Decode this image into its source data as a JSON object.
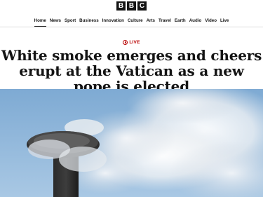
{
  "logo": {
    "letters": [
      "B",
      "B",
      "C"
    ]
  },
  "nav": {
    "items": [
      {
        "label": "Home",
        "active": true
      },
      {
        "label": "News"
      },
      {
        "label": "Sport"
      },
      {
        "label": "Business"
      },
      {
        "label": "Innovation"
      },
      {
        "label": "Culture"
      },
      {
        "label": "Arts"
      },
      {
        "label": "Travel"
      },
      {
        "label": "Earth"
      },
      {
        "label": "Audio"
      },
      {
        "label": "Video"
      },
      {
        "label": "Live"
      }
    ]
  },
  "article": {
    "live_label": "LIVE",
    "headline": "White smoke emerges and cheers erupt at the Vatican as a new pope is elected",
    "image_alt_icon": "chimney-smoke-photo"
  },
  "colors": {
    "brand_black": "#141414",
    "live_red": "#b80000",
    "sky_blue": "#8fb8dc"
  }
}
